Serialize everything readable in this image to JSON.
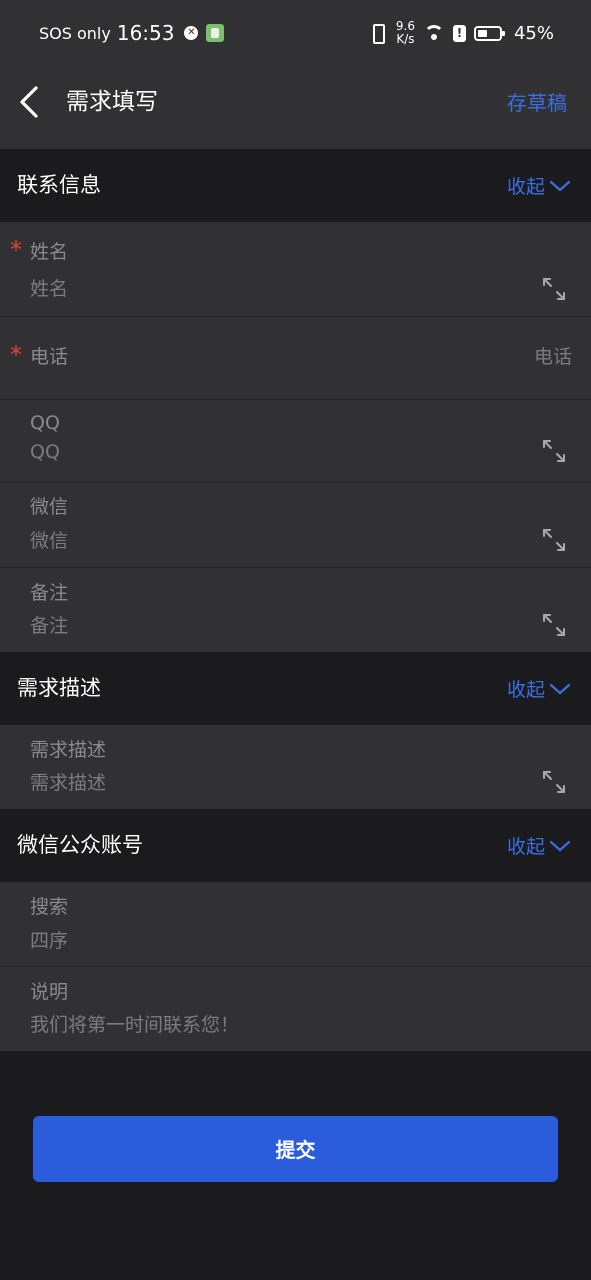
{
  "status_bar": {
    "carrier": "SOS only",
    "time": "16:53",
    "net_speed_value": "9.6",
    "net_speed_unit": "K/s",
    "battery_percent": "45%",
    "battery_level": 0.45
  },
  "header": {
    "title": "需求填写",
    "draft_label": "存草稿"
  },
  "sections": {
    "contact": {
      "title": "联系信息",
      "collapse_label": "收起"
    },
    "requirement": {
      "title": "需求描述",
      "collapse_label": "收起"
    },
    "wechat_account": {
      "title": "微信公众账号",
      "collapse_label": "收起"
    }
  },
  "fields": {
    "name": {
      "label": "姓名",
      "placeholder": "姓名",
      "required": true
    },
    "phone": {
      "label": "电话",
      "placeholder": "电话",
      "required": true
    },
    "qq": {
      "label": "QQ",
      "placeholder": "QQ"
    },
    "wechat": {
      "label": "微信",
      "placeholder": "微信"
    },
    "remark": {
      "label": "备注",
      "placeholder": "备注"
    },
    "requirement_desc": {
      "label": "需求描述",
      "placeholder": "需求描述"
    },
    "search": {
      "label": "搜索",
      "value": "四序"
    },
    "note": {
      "label": "说明",
      "value": "我们将第一时间联系您！"
    }
  },
  "required_mark": "*",
  "submit_label": "提交",
  "colors": {
    "accent": "#3b6fe6",
    "primary_button": "#2b5cdc",
    "required": "#e2452f",
    "surface": "#313133",
    "background": "#1b1b1d"
  },
  "icons": [
    "back-arrow-icon",
    "chevron-down-icon",
    "expand-arrows-icon",
    "vibrate-icon",
    "wifi-icon",
    "battery-icon"
  ]
}
